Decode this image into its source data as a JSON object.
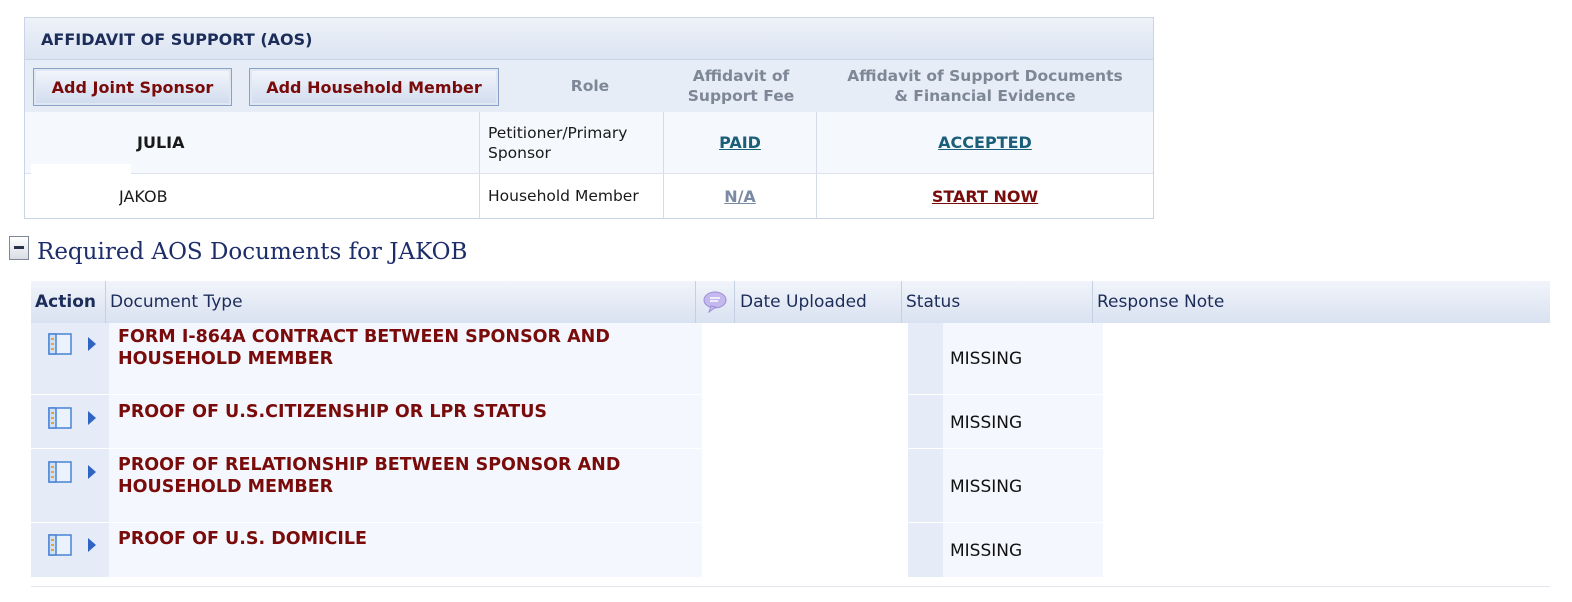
{
  "aos": {
    "title": "AFFIDAVIT OF SUPPORT (AOS)",
    "buttons": {
      "add_joint_sponsor": "Add Joint Sponsor",
      "add_household_member": "Add Household Member"
    },
    "columns": {
      "role": "Role",
      "fee_line1": "Affidavit of",
      "fee_line2": "Support Fee",
      "docs_line1": "Affidavit of Support Documents",
      "docs_line2": "& Financial Evidence"
    },
    "rows": [
      {
        "name": "JULIA",
        "role": "Petitioner/Primary Sponsor",
        "fee": "PAID",
        "docs": "ACCEPTED"
      },
      {
        "name": "JAKOB",
        "role": "Household Member",
        "fee": "N/A",
        "docs": "START NOW"
      }
    ]
  },
  "section": {
    "title": "Required AOS Documents for JAKOB",
    "collapse_icon": "collapse-minus-icon"
  },
  "documents": {
    "headers": {
      "action": "Action",
      "document_type": "Document Type",
      "comment_icon": "speech-bubble-icon",
      "date_uploaded": "Date Uploaded",
      "status": "Status",
      "response_note": "Response Note"
    },
    "rows": [
      {
        "document_type": "FORM I-864A CONTRACT BETWEEN SPONSOR AND HOUSEHOLD MEMBER",
        "date_uploaded": "",
        "status": "MISSING",
        "response_note": ""
      },
      {
        "document_type": "PROOF OF U.S.CITIZENSHIP OR LPR STATUS",
        "date_uploaded": "",
        "status": "MISSING",
        "response_note": ""
      },
      {
        "document_type": "PROOF OF RELATIONSHIP BETWEEN SPONSOR AND HOUSEHOLD MEMBER",
        "date_uploaded": "",
        "status": "MISSING",
        "response_note": ""
      },
      {
        "document_type": "PROOF OF U.S. DOMICILE",
        "date_uploaded": "",
        "status": "MISSING",
        "response_note": ""
      }
    ]
  },
  "colors": {
    "link_red": "#7a0b0b",
    "link_teal": "#1b5e7a",
    "link_gray": "#7b8aa3",
    "heading_navy": "#1d2d5a"
  }
}
